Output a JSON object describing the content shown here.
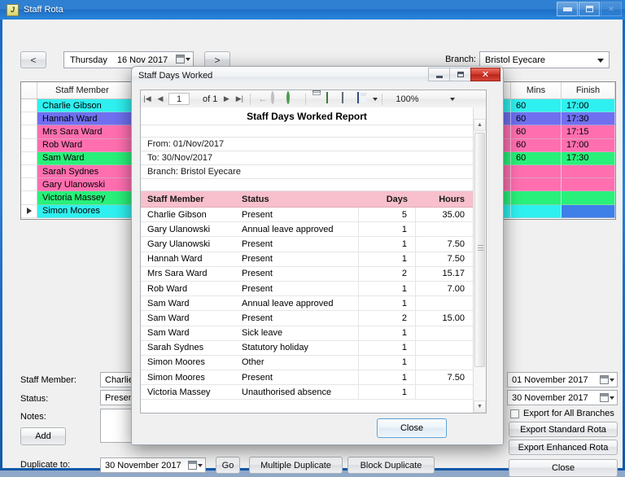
{
  "window": {
    "title": "Staff Rota",
    "icon": "app-icon",
    "buttons": {
      "minimize": "minimize",
      "maximize": "maximize",
      "close": "close"
    }
  },
  "toolbar": {
    "prev_label": "<",
    "next_label": ">",
    "date_day": "Thursday",
    "date_value": "16 Nov 2017",
    "branch_label": "Branch:",
    "branch_value": "Bristol Eyecare"
  },
  "grid": {
    "columns": [
      "",
      "Staff Member",
      "",
      "Mins",
      "Finish"
    ],
    "rows": [
      {
        "name": "Charlie Gibson",
        "mins": "60",
        "finish": "17:00",
        "color": "#2ff0f0",
        "finish_color": "#2ff0f0",
        "marker": false
      },
      {
        "name": "Hannah Ward",
        "mins": "60",
        "finish": "17:30",
        "color": "#6f6ff0",
        "finish_color": "#6f6ff0",
        "marker": false
      },
      {
        "name": "Mrs Sara Ward",
        "mins": "60",
        "finish": "17:15",
        "color": "#ff6fb0",
        "finish_color": "#ff6fb0",
        "marker": false
      },
      {
        "name": "Rob Ward",
        "mins": "60",
        "finish": "17:00",
        "color": "#ff6fb0",
        "finish_color": "#ff6fb0",
        "marker": false
      },
      {
        "name": "Sam Ward",
        "mins": "60",
        "finish": "17:30",
        "color": "#29f07a",
        "finish_color": "#29f07a",
        "marker": false
      },
      {
        "name": "Sarah Sydnes",
        "mins": "",
        "finish": "",
        "color": "#ff6fb0",
        "finish_color": "#ff6fb0",
        "marker": false
      },
      {
        "name": "Gary Ulanowski",
        "mins": "",
        "finish": "",
        "color": "#ff6fb0",
        "finish_color": "#ff6fb0",
        "marker": false
      },
      {
        "name": "Victoria Massey",
        "mins": "",
        "finish": "",
        "color": "#29f07a",
        "finish_color": "#29f07a",
        "marker": false
      },
      {
        "name": "Simon Moores",
        "mins": "",
        "finish": "",
        "color": "#2ff0f0",
        "finish_color": "#3f7fe8",
        "marker": true
      }
    ]
  },
  "form": {
    "staff_label": "Staff Member:",
    "staff_value": "Charlie Gibson",
    "status_label": "Status:",
    "status_value": "Present",
    "notes_label": "Notes:",
    "notes_value": "",
    "add_label": "Add",
    "duplicate_label": "Duplicate to:",
    "duplicate_date": "30 November 2017",
    "go_label": "Go",
    "multiple_duplicate_label": "Multiple Duplicate",
    "block_duplicate_label": "Block Duplicate"
  },
  "export": {
    "date_from": "01 November 2017",
    "date_to": "30 November 2017",
    "all_branches_label": "Export for All Branches",
    "all_branches_checked": false,
    "standard_rota_label": "Export Standard Rota",
    "enhanced_rota_label": "Export Enhanced Rota",
    "close_label": "Close"
  },
  "dialog": {
    "title": "Staff Days Worked",
    "close_button_label": "Close",
    "viewer": {
      "page_current": "1",
      "page_of": "of 1",
      "zoom": "100%",
      "icons": [
        "first-page-icon",
        "prev-page-icon",
        "next-page-icon",
        "last-page-icon",
        "back-icon",
        "stop-icon",
        "refresh-icon",
        "print-icon",
        "page-setup-icon",
        "print-layout-icon",
        "export-icon"
      ]
    },
    "report": {
      "title": "Staff Days Worked Report",
      "from": "From: 01/Nov/2017",
      "to": "To: 30/Nov/2017",
      "branch": "Branch: Bristol Eyecare",
      "columns": [
        "Staff Member",
        "Status",
        "Days",
        "Hours"
      ],
      "rows": [
        {
          "name": "Charlie Gibson",
          "status": "Present",
          "days": "5",
          "hours": "35.00"
        },
        {
          "name": "Gary Ulanowski",
          "status": "Annual leave approved",
          "days": "1",
          "hours": ""
        },
        {
          "name": "Gary Ulanowski",
          "status": "Present",
          "days": "1",
          "hours": "7.50"
        },
        {
          "name": "Hannah Ward",
          "status": "Present",
          "days": "1",
          "hours": "7.50"
        },
        {
          "name": "Mrs Sara Ward",
          "status": "Present",
          "days": "2",
          "hours": "15.17"
        },
        {
          "name": "Rob Ward",
          "status": "Present",
          "days": "1",
          "hours": "7.00"
        },
        {
          "name": "Sam Ward",
          "status": "Annual leave approved",
          "days": "1",
          "hours": ""
        },
        {
          "name": "Sam Ward",
          "status": "Present",
          "days": "2",
          "hours": "15.00"
        },
        {
          "name": "Sam Ward",
          "status": "Sick leave",
          "days": "1",
          "hours": ""
        },
        {
          "name": "Sarah Sydnes",
          "status": "Statutory holiday",
          "days": "1",
          "hours": ""
        },
        {
          "name": "Simon Moores",
          "status": "Other",
          "days": "1",
          "hours": ""
        },
        {
          "name": "Simon Moores",
          "status": "Present",
          "days": "1",
          "hours": "7.50"
        },
        {
          "name": "Victoria Massey",
          "status": "Unauthorised absence",
          "days": "1",
          "hours": ""
        }
      ]
    }
  },
  "colors": {
    "accent": "#2f80d2",
    "report_header": "#f7c0cc",
    "dialog_close_red": "#cf3427"
  }
}
